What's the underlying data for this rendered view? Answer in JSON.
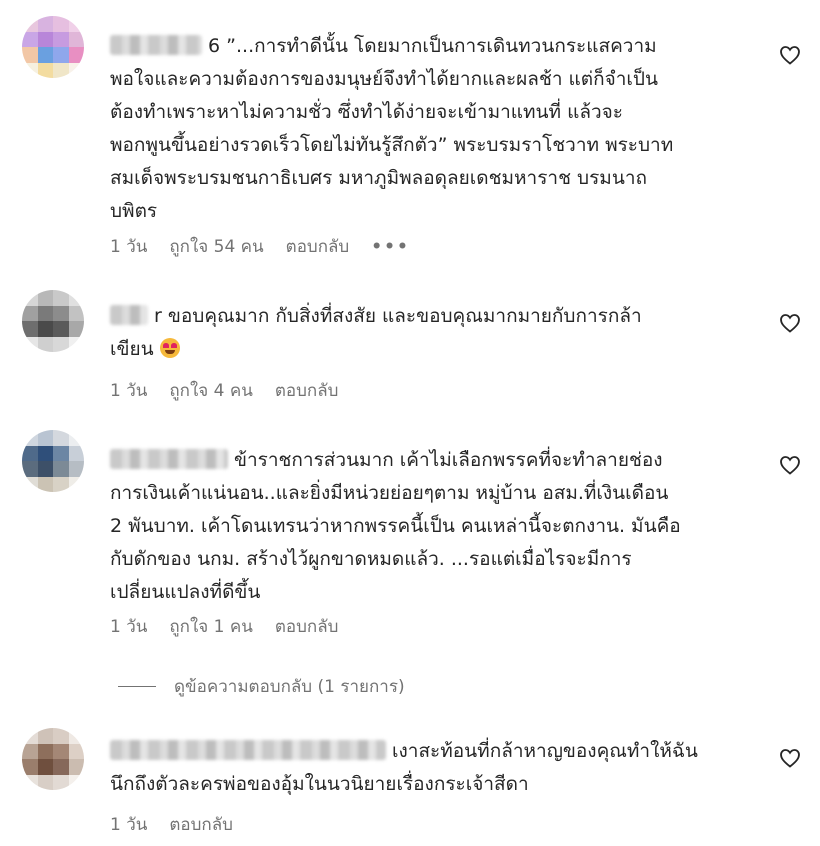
{
  "comments": [
    {
      "username_suffix": "6",
      "text": "”...การทำดีนั้น โดยมากเป็นการเดินทวนกระแสความ\nพอใจและความต้องการของมนุษย์จึงทำได้ยากและผลช้า แต่ก็จำเป็น\nต้องทำเพราะหาไม่ความชั่ว ซึ่งทำได้ง่ายจะเข้ามาแทนที่ แล้วจะ\nพอกพูนขึ้นอย่างรวดเร็วโดยไม่ทันรู้สึกตัว” พระบรมราโชวาท พระบาท\nสมเด็จพระบรมชนกาธิเบศร มหาภูมิพลอดุลยเดชมหาราช บรมนาถ\nบพิตร",
      "time": "1 วัน",
      "likes": "ถูกใจ 54 คน",
      "reply": "ตอบกลับ",
      "more": "•••"
    },
    {
      "username_suffix": "r",
      "text": "ขอบคุณมาก กับสิ่งที่สงสัย และขอบคุณมากมายกับการกล้า\nเขียน",
      "emoji": "heart-eyes-emoji",
      "time": "1 วัน",
      "likes": "ถูกใจ 4 คน",
      "reply": "ตอบกลับ"
    },
    {
      "username_suffix": "",
      "text": "ข้าราชการส่วนมาก เค้าไม่เลือกพรรคที่จะทำลายช่อง\nการเงินเค้าแน่นอน..และยิ่งมีหน่วยย่อยๆตาม หมู่บ้าน อสม.ที่เงินเดือน\n2 พันบาท. เค้าโดนเทรนว่าหากพรรคนี้เป็น คนเหล่านี้จะตกงาน. มันคือ\nกับดักของ นกม. สร้างไว้ผูกขาดหมดแล้ว. ...รอแต่เมื่อไรจะมีการ\nเปลี่ยนแปลงที่ดีขึ้น",
      "time": "1 วัน",
      "likes": "ถูกใจ 1 คน",
      "reply": "ตอบกลับ",
      "view_replies": "ดูข้อความตอบกลับ (1 รายการ)"
    },
    {
      "username_suffix": "",
      "text": "เงาสะท้อนที่กล้าหาญของคุณทำให้ฉัน\nนึกถึงตัวละครพ่อของอุ้มในนวนิยายเรื่องกระเจ้าสีดา",
      "time": "1 วัน",
      "reply": "ตอบกลับ"
    }
  ],
  "icons": {
    "like": "heart-outline-icon"
  },
  "colors": {
    "text": "#262626",
    "meta": "#737373"
  }
}
